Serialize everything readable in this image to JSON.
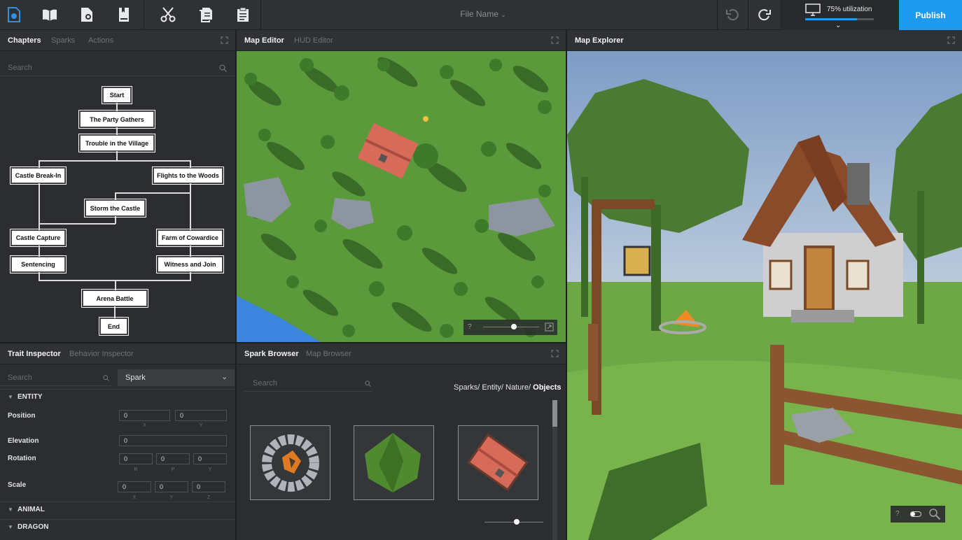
{
  "toolbar": {
    "file_name": "File Name",
    "utilization_text": "75% utilization",
    "utilization_value": 0.75,
    "publish_label": "Publish"
  },
  "chapters_panel": {
    "tabs": [
      "Chapters",
      "Sparks",
      "Actions"
    ],
    "search_placeholder": "Search",
    "nodes": {
      "start": "Start",
      "party": "The Party Gathers",
      "trouble": "Trouble in the Village",
      "breakin": "Castle Break-In",
      "flights": "Flights to the Woods",
      "storm": "Storm the Castle",
      "capture": "Castle Capture",
      "farm": "Farm of Cowardice",
      "sentencing": "Sentencing",
      "witness": "Witness and Join",
      "arena": "Arena Battle",
      "end": "End"
    }
  },
  "map_editor_panel": {
    "tabs": [
      "Map Editor",
      "HUD Editor"
    ],
    "help": "?",
    "zoom_level": 0.55
  },
  "map_explorer_panel": {
    "tabs": [
      "Map Explorer"
    ],
    "help": "?"
  },
  "trait_inspector": {
    "tabs": [
      "Trait Inspector",
      "Behavior Inspector"
    ],
    "search_placeholder": "Search",
    "type_select": "Spark",
    "entity_section": "ENTITY",
    "position_label": "Position",
    "position": {
      "x": "0",
      "y": "0",
      "x_lbl": "X",
      "y_lbl": "Y"
    },
    "elevation_label": "Elevation",
    "elevation": "0",
    "rotation_label": "Rotation",
    "rotation": {
      "r": "0",
      "p": "0",
      "y": "0",
      "r_lbl": "R",
      "p_lbl": "P",
      "y_lbl": "Y"
    },
    "scale_label": "Scale",
    "scale": {
      "x": "0",
      "y": "0",
      "z": "0",
      "x_lbl": "X",
      "y_lbl": "Y",
      "z_lbl": "Z"
    },
    "animal_section": "ANIMAL",
    "dragon_section": "DRAGON"
  },
  "spark_browser": {
    "tabs": [
      "Spark Browser",
      "Map Browser"
    ],
    "search_placeholder": "Search",
    "breadcrumb": [
      "Sparks/",
      "Entity/",
      "Nature/",
      "Objects"
    ],
    "zoom_level": 0.55
  },
  "colors": {
    "accent": "#1e9bf0",
    "panel": "#2b2d30",
    "grass": "#5a9a3a",
    "sky": "#8ea8c8"
  }
}
